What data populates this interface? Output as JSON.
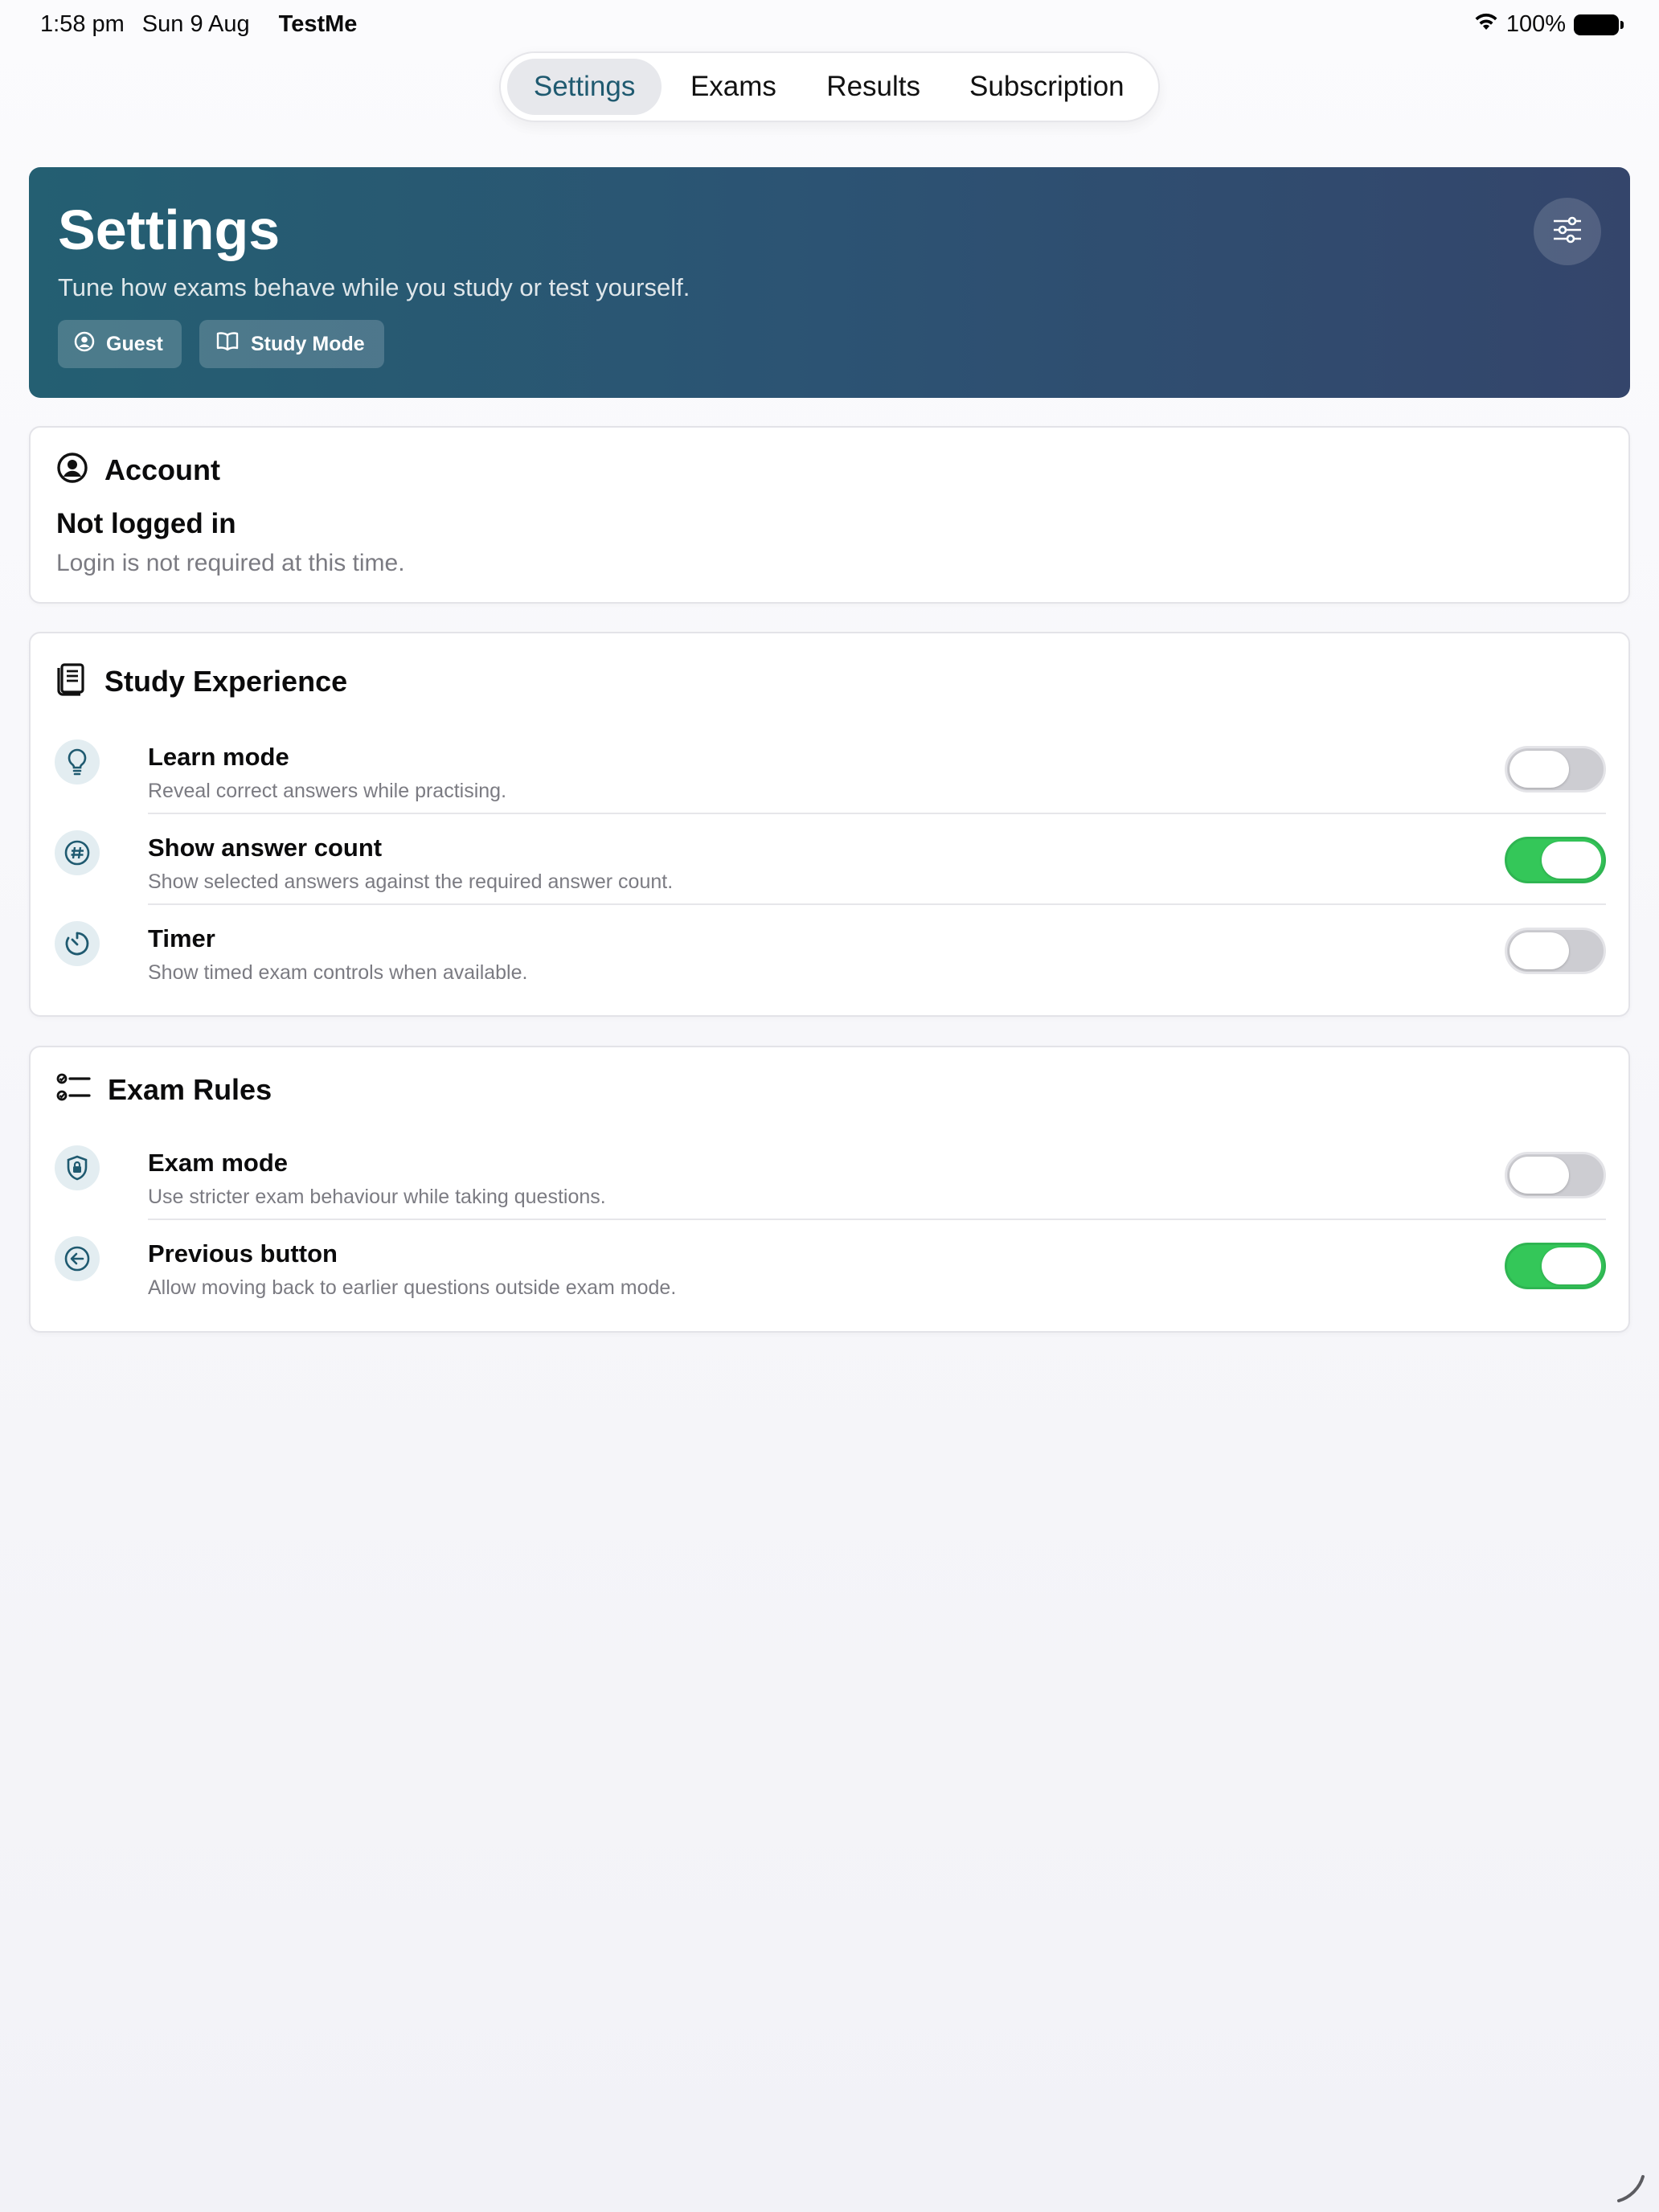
{
  "status_bar": {
    "time": "1:58 pm",
    "date": "Sun 9 Aug",
    "app_name": "TestMe",
    "battery": "100%"
  },
  "tabs": [
    {
      "label": "Settings",
      "active": true
    },
    {
      "label": "Exams",
      "active": false
    },
    {
      "label": "Results",
      "active": false
    },
    {
      "label": "Subscription",
      "active": false
    }
  ],
  "hero": {
    "title": "Settings",
    "subtitle": "Tune how exams behave while you study or test yourself.",
    "chips": [
      {
        "label": "Guest",
        "icon": "user-circle-icon"
      },
      {
        "label": "Study Mode",
        "icon": "book-icon"
      }
    ],
    "action_icon": "sliders-icon",
    "gradient_start": "#245f72",
    "gradient_end": "#34456b"
  },
  "account": {
    "title": "Account",
    "status": "Not logged in",
    "note": "Login is not required at this time."
  },
  "study_experience": {
    "title": "Study Experience",
    "items": [
      {
        "label": "Learn mode",
        "description": "Reveal correct answers while practising.",
        "icon": "lightbulb-icon",
        "enabled": false
      },
      {
        "label": "Show answer count",
        "description": "Show selected answers against the required answer count.",
        "icon": "hash-icon",
        "enabled": true
      },
      {
        "label": "Timer",
        "description": "Show timed exam controls when available.",
        "icon": "timer-icon",
        "enabled": false
      }
    ]
  },
  "exam_rules": {
    "title": "Exam Rules",
    "items": [
      {
        "label": "Exam mode",
        "description": "Use stricter exam behaviour while taking questions.",
        "icon": "shield-lock-icon",
        "enabled": false
      },
      {
        "label": "Previous button",
        "description": "Allow moving back to earlier questions outside exam mode.",
        "icon": "arrow-left-circle-icon",
        "enabled": true
      }
    ]
  },
  "colors": {
    "accent": "#1f5a70",
    "toggle_on": "#34c759",
    "toggle_off": "#cdcdd2"
  }
}
